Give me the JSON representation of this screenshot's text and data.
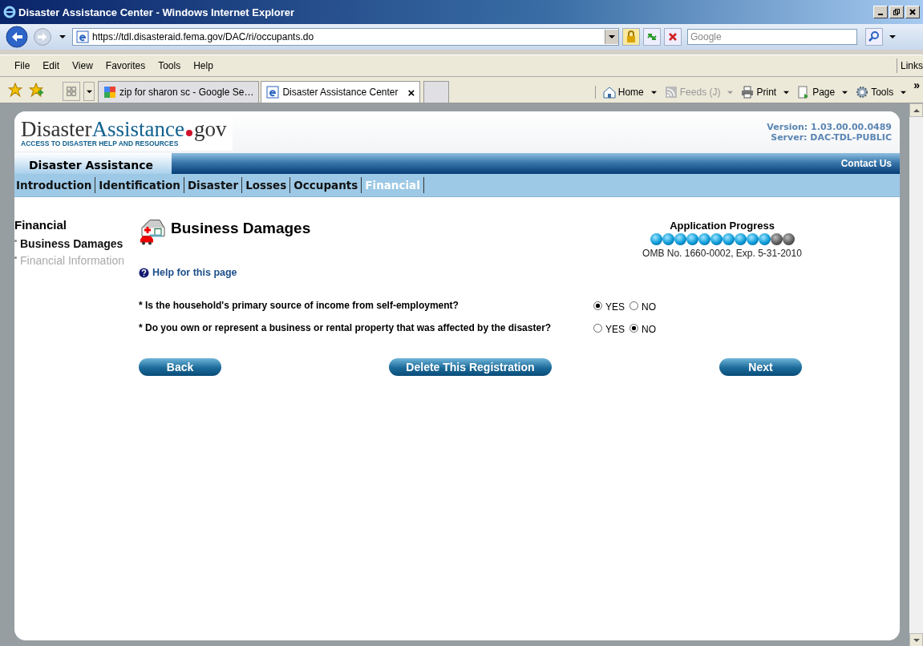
{
  "window": {
    "title": "Disaster Assistance Center - Windows Internet Explorer"
  },
  "address_bar": {
    "url": "https://tdl.disasteraid.fema.gov/DAC/ri/occupants.do",
    "search_placeholder": "Google"
  },
  "menu": [
    "File",
    "Edit",
    "View",
    "Favorites",
    "Tools",
    "Help"
  ],
  "links_label": "Links",
  "browser_tabs": [
    {
      "label": "zip for sharon sc - Google Se…",
      "selected": false
    },
    {
      "label": "Disaster Assistance Center",
      "selected": true,
      "close": "×"
    }
  ],
  "commands": [
    {
      "label": "Home",
      "disabled": false
    },
    {
      "label": "Feeds (J)",
      "disabled": true
    },
    {
      "label": "Print",
      "disabled": false
    },
    {
      "label": "Page",
      "disabled": false
    },
    {
      "label": "Tools",
      "disabled": false
    }
  ],
  "chevron": "»",
  "site": {
    "logo_dark": "Disaster",
    "logo_blue": "Assistance",
    "logo_gov": "gov",
    "tagline": "ACCESS TO DISASTER HELP AND RESOURCES",
    "version": "Version: 1.03.00.00.0489",
    "server": "Server: DAC-TDL-PUBLIC",
    "section_tab": "Disaster Assistance",
    "contact": "Contact Us"
  },
  "nav_tabs": [
    {
      "label": "Introduction",
      "selected": false
    },
    {
      "label": "Identification",
      "selected": false
    },
    {
      "label": "Disaster",
      "selected": false
    },
    {
      "label": "Losses",
      "selected": false
    },
    {
      "label": "Occupants",
      "selected": false
    },
    {
      "label": "Financial",
      "selected": true
    }
  ],
  "sidebar": {
    "heading": "Financial",
    "items": [
      {
        "label": "Business Damages",
        "selected": true
      },
      {
        "label": "Financial Information",
        "selected": false
      }
    ]
  },
  "page_title": "Business Damages",
  "help_link": "Help for this page",
  "progress": {
    "title": "Application Progress",
    "steps": [
      {
        "done": true
      },
      {
        "done": true
      },
      {
        "done": true
      },
      {
        "done": true
      },
      {
        "done": true
      },
      {
        "done": true
      },
      {
        "done": true
      },
      {
        "done": true
      },
      {
        "done": true
      },
      {
        "done": true
      },
      {
        "done": false
      },
      {
        "done": false
      }
    ],
    "omb": "OMB No. 1660-0002, Exp. 5-31-2010"
  },
  "questions": [
    {
      "text": "* Is the household's primary source of income from self-employment?",
      "options": [
        {
          "label": "YES",
          "selected": true
        },
        {
          "label": "NO",
          "selected": false
        }
      ]
    },
    {
      "text": "* Do you own or represent a business or rental property that was affected by the disaster?",
      "options": [
        {
          "label": "YES",
          "selected": false
        },
        {
          "label": "NO",
          "selected": true
        }
      ]
    }
  ],
  "buttons": [
    "Back",
    "Delete This Registration",
    "Next"
  ]
}
